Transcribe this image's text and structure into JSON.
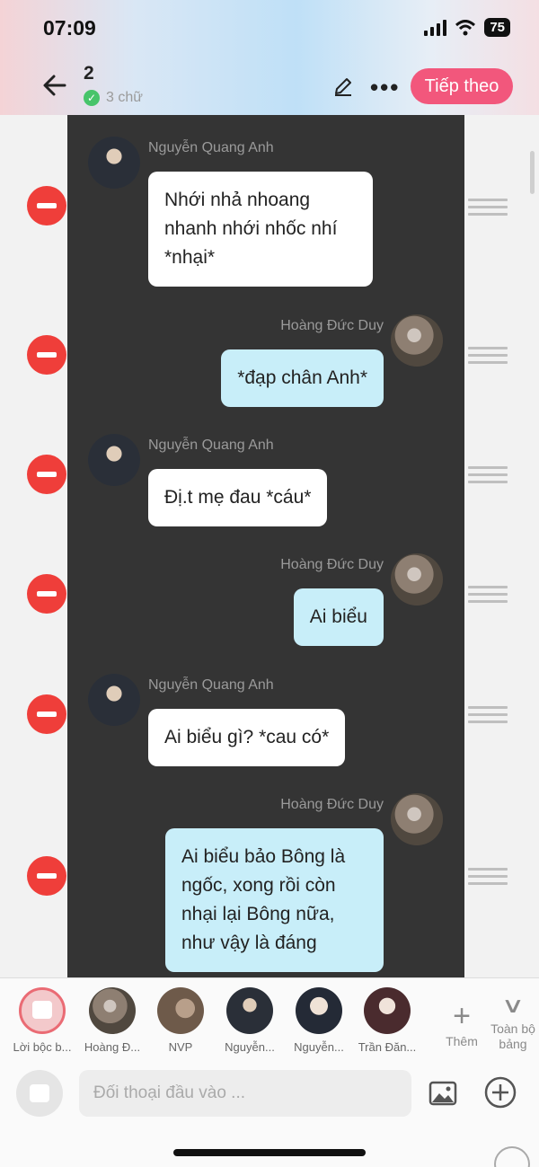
{
  "status_bar": {
    "time": "07:09",
    "battery": "75"
  },
  "header": {
    "count": "2",
    "word_count": "3 chữ",
    "next_label": "Tiếp theo"
  },
  "messages": [
    {
      "speaker": "Nguyễn Quang Anh",
      "side": "left",
      "text": "Nhới nhả nhoang nhanh nhới nhốc nhí *nhại*"
    },
    {
      "speaker": "Hoàng Đức Duy",
      "side": "right",
      "text": "*đạp chân Anh*"
    },
    {
      "speaker": "Nguyễn Quang Anh",
      "side": "left",
      "text": "Đị.t mẹ đau *cáu*"
    },
    {
      "speaker": "Hoàng Đức Duy",
      "side": "right",
      "text": "Ai biểu"
    },
    {
      "speaker": "Nguyễn Quang Anh",
      "side": "left",
      "text": "Ai biểu gì? *cau có*"
    },
    {
      "speaker": "Hoàng Đức Duy",
      "side": "right",
      "text": "Ai biểu bảo Bông là ngốc, xong rồi còn nhại lại Bông nữa, như vậy là đáng"
    }
  ],
  "characters": [
    {
      "label": "Lời bộc b..."
    },
    {
      "label": "Hoàng Đ..."
    },
    {
      "label": "NVP"
    },
    {
      "label": "Nguyễn..."
    },
    {
      "label": "Nguyễn..."
    },
    {
      "label": "Trần Đăn..."
    }
  ],
  "add_character_label": "Thêm",
  "board_label": "Toàn bộ bảng",
  "input": {
    "placeholder": "Đối thoại đầu vào ..."
  },
  "colors": {
    "accent": "#f2577c",
    "delete": "#ef3e3a",
    "bubble_right": "#c8eef9",
    "chat_bg": "#343434"
  }
}
